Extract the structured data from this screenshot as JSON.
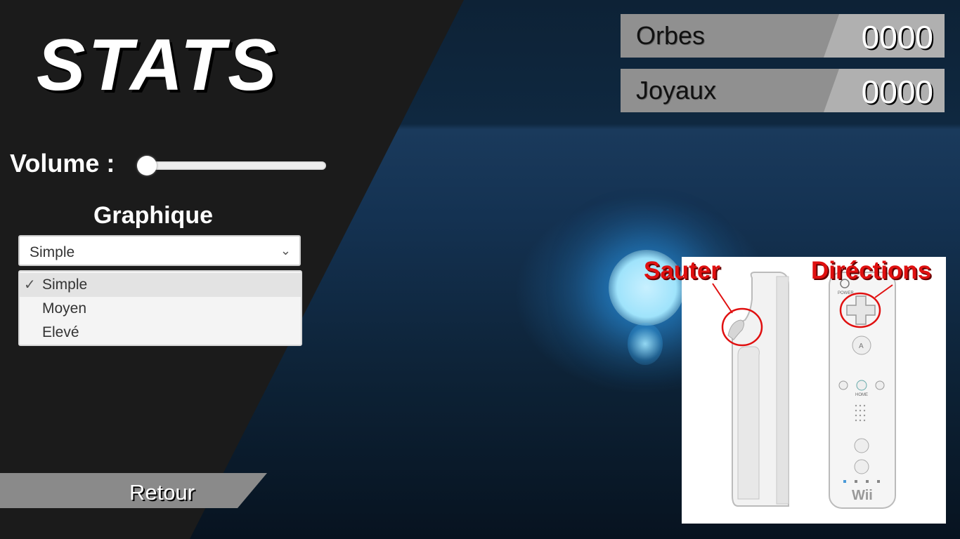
{
  "title": "STATS",
  "volume": {
    "label": "Volume :",
    "level": 0.0
  },
  "graphics": {
    "label": "Graphique",
    "selected": "Simple",
    "options": [
      "Simple",
      "Moyen",
      "Elevé"
    ]
  },
  "back_button": {
    "label": "Retour"
  },
  "stats": [
    {
      "name": "Orbes",
      "value": "0000"
    },
    {
      "name": "Joyaux",
      "value": "0000"
    }
  ],
  "controls_image": {
    "jump_label": "Sauter",
    "directions_label": "Diréctions",
    "brand_text": "Wii",
    "power_text": "POWER",
    "home_text": "HOME"
  },
  "icons": {
    "dropdown_arrow": "chevron-down-icon",
    "selected_option": "check-icon"
  }
}
